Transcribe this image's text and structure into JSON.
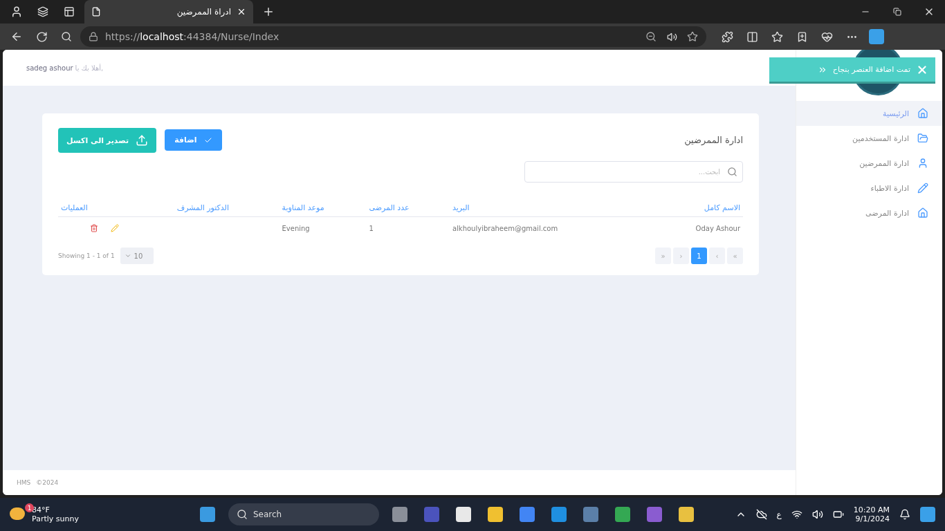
{
  "browser": {
    "tab_title": "ادراة الممرضين",
    "url_scheme": "https://",
    "url_host": "localhost",
    "url_path": ":44384/Nurse/Index"
  },
  "header": {
    "greeting": "أهلا بك يا,",
    "user": "sadeg ashour"
  },
  "toast": {
    "message": "تمت اضافة العنصر بنجاح"
  },
  "sidebar": {
    "items": [
      {
        "label": "الرئيسية",
        "selected": true
      },
      {
        "label": "ادارة المستخدمين",
        "selected": false
      },
      {
        "label": "ادارة الممرضين",
        "selected": false
      },
      {
        "label": "ادارة الاطباء",
        "selected": false
      },
      {
        "label": "ادارة المرضى",
        "selected": false
      }
    ]
  },
  "page": {
    "title": "ادارة الممرضين",
    "add_button": "اضافة",
    "export_button": "تصدير الى اكسل",
    "search": {
      "placeholder": "ابحث..."
    }
  },
  "table": {
    "columns": [
      "الاسم كامل",
      "البريد",
      "عدد المرضى",
      "موعد المناوبة",
      "الدكتور المشرف",
      "العمليات"
    ],
    "rows": [
      {
        "name": "Oday Ashour",
        "email": "alkhoulyibraheem@gmail.com",
        "patients": "1",
        "shift": "Evening"
      }
    ]
  },
  "pagination": {
    "pages": [
      {
        "label": "«",
        "selected": false
      },
      {
        "label": "‹",
        "selected": false
      },
      {
        "label": "1",
        "selected": true
      },
      {
        "label": "›",
        "selected": false
      },
      {
        "label": "»",
        "selected": false
      }
    ],
    "showing": "Showing 1 - 1 of 1",
    "page_size": "10"
  },
  "footer": {
    "brand": "HMS",
    "year": "©2024"
  },
  "taskbar": {
    "weather_badge": "1",
    "temperature": "84°F",
    "condition": "Partly sunny",
    "search": "Search",
    "language": "ع",
    "time": "10:20 AM",
    "date": "9/1/2024"
  }
}
